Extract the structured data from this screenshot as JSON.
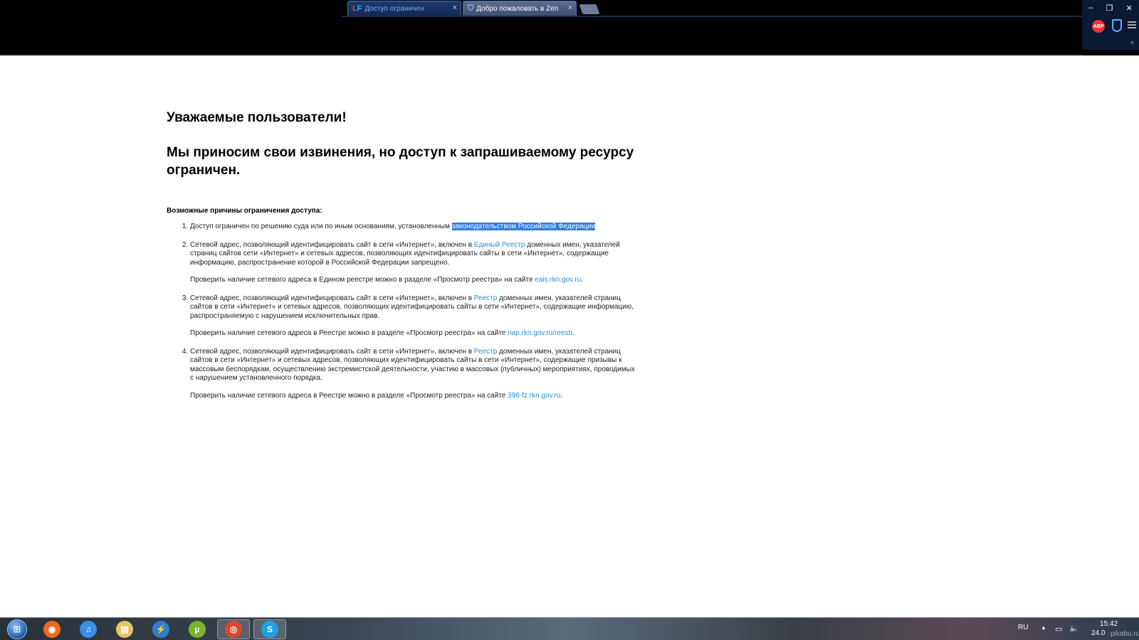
{
  "browser": {
    "tabs": [
      {
        "favicon": "LF",
        "label": "Доступ ограничен",
        "state": "active"
      },
      {
        "favicon": "shield-icon",
        "label": "Добро пожаловать в Zen",
        "state": "inactive"
      }
    ],
    "tab_close": "×",
    "window_controls": {
      "minimize": "–",
      "restore": "❐",
      "close": "✕"
    },
    "extensions": {
      "abp": "ABP"
    },
    "overflow": "»"
  },
  "page": {
    "greeting": "Уважаемые пользователи!",
    "apology": "Мы приносим свои извинения, но доступ к запрашиваемому ресурсу ограничен.",
    "reasons_title": "Возможные причины ограничения доступа:",
    "reasons": [
      {
        "text_before": "Доступ ограничен  по решению суда или по иным основаниям, установленным ",
        "highlight": "законодательством Российской Федерации"
      },
      {
        "text_before": "Сетевой адрес, позволяющий идентифицировать сайт в сети «Интернет», включен в ",
        "link": "Единый Реестр",
        "text_after": " доменных имен, указателей страниц сайтов сети «Интернет» и сетевых адресов, позволяющих идентифицировать сайты в сети «Интернет», содержащие информацию, распространение которой в Российской Федерации запрещено.",
        "check_before": "Проверить наличие сетевого адреса в Едином реестре можно в разделе «Просмотр реестра» на сайте ",
        "check_link": "eais.rkn.gov.ru",
        "check_after": "."
      },
      {
        "text_before": "Сетевой адрес, позволяющий идентифицировать сайт в сети «Интернет», включен в ",
        "link": "Реестр",
        "text_after": " доменных имен, указателей страниц сайтов в сети «Интернет» и сетевых адресов, позволяющих идентифицировать сайты в сети «Интернет», содержащие информацию, распространяемую с нарушением исключительных прав.",
        "check_before": "Проверить наличие сетевого адреса в Реестре можно в разделе «Просмотр реестра» на сайте ",
        "check_link": "nap.rkn.gov.ru/reestr",
        "check_after": "."
      },
      {
        "text_before": "Сетевой адрес, позволяющий идентифицировать сайт в сети «Интернет», включен в ",
        "link": "Реестр",
        "text_after": " доменных имен, указателей страниц сайтов в сети «Интернет» и сетевых адресов, позволяющих идентифицировать сайты в сети «Интернет», содержащие призывы к массовым беспорядкам, осуществлению экстремистской деятельности, участию в массовых (публичных) мероприятиях, проводимых с нарушением установленного порядка.",
        "check_before": "Проверить наличие сетевого адреса в Реестре можно в разделе «Просмотр реестра» на сайте ",
        "check_link": "398-fz.rkn.gov.ru",
        "check_after": "."
      }
    ]
  },
  "taskbar": {
    "apps": [
      {
        "name": "origin-icon",
        "glyph": "◉",
        "color": "#f06a1f"
      },
      {
        "name": "itunes-icon",
        "glyph": "♫",
        "color": "#3a8ee6"
      },
      {
        "name": "file-explorer-icon",
        "glyph": "▤",
        "color": "#e8c463"
      },
      {
        "name": "downloader-icon",
        "glyph": "⚡",
        "color": "#2f7fd0"
      },
      {
        "name": "utorrent-icon",
        "glyph": "µ",
        "color": "#7ab32e"
      },
      {
        "name": "chrome-icon",
        "glyph": "◎",
        "color": "#e0442f",
        "active": true
      },
      {
        "name": "skype-icon",
        "glyph": "S",
        "color": "#1ea1e6",
        "active": true
      }
    ],
    "tray": {
      "language": "RU",
      "time": "15:42",
      "date": "24.0",
      "watermark": "pikabu.ru"
    }
  },
  "colors": {
    "link": "#2a8fd6",
    "highlight": "#2e7ce0",
    "chrome_bg": "#000000"
  }
}
